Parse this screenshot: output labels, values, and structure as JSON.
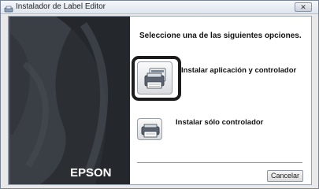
{
  "window": {
    "title": "Instalador de Label Editor",
    "close_glyph": "✕"
  },
  "left_panel": {
    "brand": "EPSON"
  },
  "main": {
    "prompt": "Seleccione una de las siguientes opciones.",
    "options": [
      {
        "label": "Instalar aplicación  y controlador",
        "icon": "printer-app-icon",
        "focused": true
      },
      {
        "label": "Instalar sólo controlador",
        "icon": "printer-icon",
        "focused": false
      }
    ],
    "cancel_label": "Cancelar"
  },
  "colors": {
    "panel_dark": "#2b2e33",
    "focus_ring": "#1c1c1c"
  }
}
